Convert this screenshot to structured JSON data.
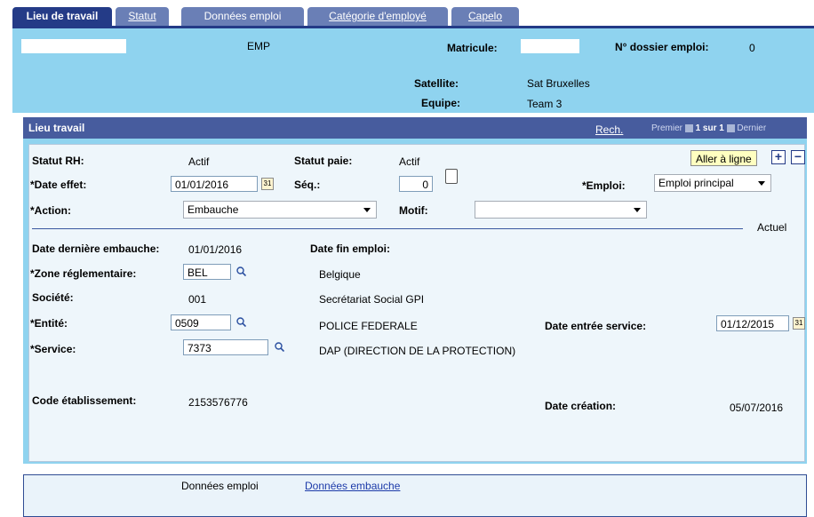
{
  "tabs": [
    {
      "label": "Lieu de travail",
      "active": true
    },
    {
      "label": "Statut",
      "active": false
    },
    {
      "label": "Données emploi",
      "active": false
    },
    {
      "label": "Catégorie d'employé",
      "active": false
    },
    {
      "label": "Capelo",
      "active": false
    }
  ],
  "header": {
    "emp": "EMP",
    "matricule_label": "Matricule:",
    "dossier_label": "N° dossier emploi:",
    "dossier_value": "0",
    "satellite_label": "Satellite:",
    "satellite_value": "Sat Bruxelles",
    "equipe_label": "Equipe:",
    "equipe_value": "Team 3"
  },
  "panel": {
    "title": "Lieu travail",
    "search_link": "Rech.",
    "nav_first": "Premier",
    "nav_count": "1 sur 1",
    "nav_last": "Dernier"
  },
  "form": {
    "statut_rh_label": "Statut RH:",
    "statut_rh_value": "Actif",
    "statut_paie_label": "Statut paie:",
    "statut_paie_value": "Actif",
    "aller_button": "Aller à ligne",
    "plus": "+",
    "minus": "−",
    "date_effet_label": "*Date effet:",
    "date_effet_value": "01/01/2016",
    "seq_label": "Séq.:",
    "seq_value": "0",
    "emploi_label": "*Emploi:",
    "emploi_value": "Emploi principal",
    "action_label": "*Action:",
    "action_value": "Embauche",
    "motif_label": "Motif:",
    "motif_value": "",
    "actuel": "Actuel",
    "derniere_embauche_label": "Date dernière embauche:",
    "derniere_embauche_value": "01/01/2016",
    "fin_emploi_label": "Date fin emploi:",
    "zone_label": "*Zone réglementaire:",
    "zone_value": "BEL",
    "zone_desc": "Belgique",
    "societe_label": "Société:",
    "societe_value": "001",
    "societe_desc": "Secrétariat Social GPI",
    "entite_label": "*Entité:",
    "entite_value": "0509",
    "entite_desc": "POLICE FEDERALE",
    "entree_service_label": "Date entrée service:",
    "entree_service_value": "01/12/2015",
    "service_label": "*Service:",
    "service_value": "7373",
    "service_desc": "DAP (DIRECTION DE LA PROTECTION)",
    "code_etab_label": "Code établissement:",
    "code_etab_value": "2153576776",
    "date_creation_label": "Date création:",
    "date_creation_value": "05/07/2016"
  },
  "footer": {
    "donnees_emploi": "Données emploi",
    "donnees_embauche": "Données embauche"
  },
  "icons": {
    "calendar": "calendar-icon",
    "lookup": "search-icon",
    "note": "note-icon"
  },
  "colors": {
    "tab_active": "#243b87",
    "tab_inactive": "#6a7fb6",
    "header_bg": "#8fd3ef",
    "panel_head": "#475c9e",
    "link": "#1c3aa9"
  }
}
